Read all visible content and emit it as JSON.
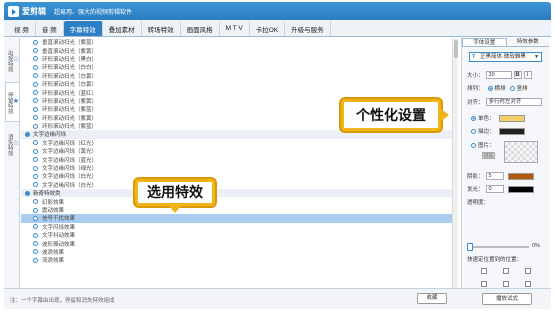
{
  "app": {
    "name": "爱剪辑",
    "subtitle": "超易用、强大的视频剪辑软件"
  },
  "menu": [
    "视 频",
    "音 频",
    "字幕特效",
    "叠加素材",
    "转场特效",
    "画面风格",
    "M T V",
    "卡拉OK",
    "升级与服务"
  ],
  "menu_active": 2,
  "side_tabs": [
    {
      "icon": "☆",
      "label": "出现特效"
    },
    {
      "icon": "★",
      "label": "停留特效"
    },
    {
      "icon": "☆",
      "label": "消失特效"
    }
  ],
  "effects": [
    {
      "type": "item",
      "label": "垂直滚动扫光（紫蓝）"
    },
    {
      "type": "item",
      "label": "垂直滚动扫光（紫黄）"
    },
    {
      "type": "item",
      "label": "环形滚动扫光（黑白）"
    },
    {
      "type": "item",
      "label": "环形滚动扫光（白白）"
    },
    {
      "type": "item",
      "label": "环形滚动扫光（白黄）"
    },
    {
      "type": "item",
      "label": "环形滚动扫光（白黄）"
    },
    {
      "type": "item",
      "label": "环形滚动扫光（蓝红）"
    },
    {
      "type": "item",
      "label": "环形滚动扫光（紫黄）"
    },
    {
      "type": "item",
      "label": "环形滚动扫光（紫蓝）"
    },
    {
      "type": "item",
      "label": "环形滚动扫光（紫黄）"
    },
    {
      "type": "item",
      "label": "环形滚动扫光（紫蓝）"
    },
    {
      "type": "group",
      "label": "文字边缘闪烁"
    },
    {
      "type": "item",
      "label": "文字边缘闪烁（红光）"
    },
    {
      "type": "item",
      "label": "文字边缘闪烁（黄光）"
    },
    {
      "type": "item",
      "label": "文字边缘闪烁（蓝光）"
    },
    {
      "type": "item",
      "label": "文字边缘闪烁（绿光）"
    },
    {
      "type": "item",
      "label": "文字边缘闪烁（白光）"
    },
    {
      "type": "item",
      "label": "文字边缘闪烁（白光）"
    },
    {
      "type": "group",
      "label": "新奇特效类"
    },
    {
      "type": "item",
      "label": "幻影效果"
    },
    {
      "type": "item",
      "label": "震动效果"
    },
    {
      "type": "item",
      "label": "信号干扰效果",
      "selected": true
    },
    {
      "type": "item",
      "label": "文字闪烁效果"
    },
    {
      "type": "item",
      "label": "文字抖动效果"
    },
    {
      "type": "item",
      "label": "波形振动效果"
    },
    {
      "type": "item",
      "label": "波浪效果"
    },
    {
      "type": "item",
      "label": "流浪效果"
    }
  ],
  "right_panel": {
    "tabs": [
      "字体设置",
      "特效参数"
    ],
    "font": "正黑简体·微软雅黑",
    "size_label": "大小：",
    "size": "30",
    "bold": "B",
    "italic": "I",
    "orient_label": "排列：",
    "orient_h": "横排",
    "orient_v": "竖排",
    "align_label": "对齐：",
    "align": "多行时左对齐",
    "mono_label": "单色：",
    "border_label": "描边：",
    "image_label": "图片：",
    "browse": "浏览",
    "shadow_label": "阴影：",
    "shadow_val": "5",
    "glow_label": "发光：",
    "glow_val": "0",
    "opacity_label": "透明度：",
    "opacity": "0%",
    "opacity_value": 0,
    "pos_label": "快速定位置到的位置："
  },
  "bottom": {
    "tip": "注：一个字幕由出现，停留和消失特效组成",
    "fav": "收藏",
    "apply": "播放试式"
  },
  "callouts": {
    "effect": "选用特效",
    "personal": "个性化设置"
  },
  "colors": {
    "accent": "#2e7fc4",
    "highlight": "#f0b51c",
    "mono": "#f5d06a",
    "border": "#222222",
    "shadow": "#b05a10",
    "glow": "#000000"
  }
}
